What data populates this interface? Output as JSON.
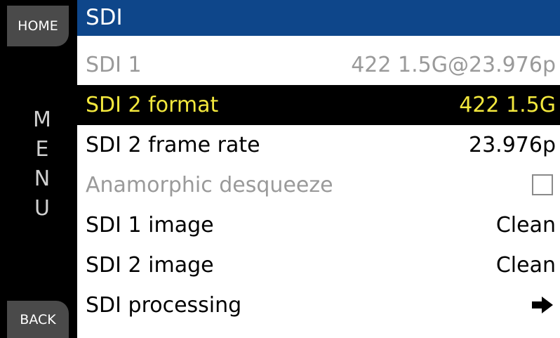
{
  "sidebar": {
    "home_label": "HOME",
    "menu_letters": [
      "M",
      "E",
      "N",
      "U"
    ],
    "back_label": "BACK"
  },
  "header": {
    "title": "SDI"
  },
  "menu": {
    "items": [
      {
        "label": "SDI 1",
        "value": "422 1.5G@23.976p",
        "state": "disabled"
      },
      {
        "label": "SDI 2 format",
        "value": "422 1.5G",
        "state": "selected"
      },
      {
        "label": "SDI 2 frame rate",
        "value": "23.976p",
        "state": "normal"
      },
      {
        "label": "Anamorphic desqueeze",
        "value": "",
        "state": "disabled",
        "control": "checkbox",
        "checked": false
      },
      {
        "label": "SDI 1 image",
        "value": "Clean",
        "state": "normal"
      },
      {
        "label": "SDI 2 image",
        "value": "Clean",
        "state": "normal"
      },
      {
        "label": "SDI processing",
        "value": "",
        "state": "normal",
        "control": "arrow-right-icon"
      }
    ]
  },
  "colors": {
    "title_bar": "#0e468a",
    "selected_bg": "#000000",
    "selected_text": "#f3e83d",
    "disabled_text": "#9a9a9a",
    "softkey_bg": "#4a4a4a"
  }
}
